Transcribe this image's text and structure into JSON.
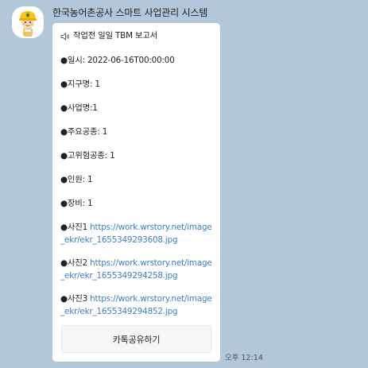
{
  "sender": {
    "name": "한국농어촌공사 스마트 사업관리 시스템"
  },
  "message": {
    "title": "작업전 일일 TBM 보고서",
    "bullet": "●",
    "fields": [
      {
        "label": "일시: ",
        "value": "2022-06-16T00:00:00"
      },
      {
        "label": "지구명: ",
        "value": "1"
      },
      {
        "label": "사업명:",
        "value": "1"
      },
      {
        "label": "주요공종: ",
        "value": "1"
      },
      {
        "label": "고위험공종: ",
        "value": "1"
      },
      {
        "label": "인원: ",
        "value": "1"
      },
      {
        "label": "장비: ",
        "value": "1"
      }
    ],
    "photos": [
      {
        "label": "사진1 ",
        "url": "https://work.wrstory.net/image_ekr/ekr_1655349293608.jpg"
      },
      {
        "label": "사진2 ",
        "url": "https://work.wrstory.net/image_ekr/ekr_1655349294258.jpg"
      },
      {
        "label": "사진3 ",
        "url": "https://work.wrstory.net/image_ekr/ekr_1655349294852.jpg"
      }
    ],
    "share_button": "카톡공유하기",
    "time": "오후 12:14"
  },
  "icons": {
    "title": "speaker-icon",
    "avatar": "construction-worker-icon"
  },
  "colors": {
    "background": "#b2c7da",
    "link": "#3b7ec2",
    "bubble": "#ffffff",
    "helmet": "#f5c518"
  }
}
